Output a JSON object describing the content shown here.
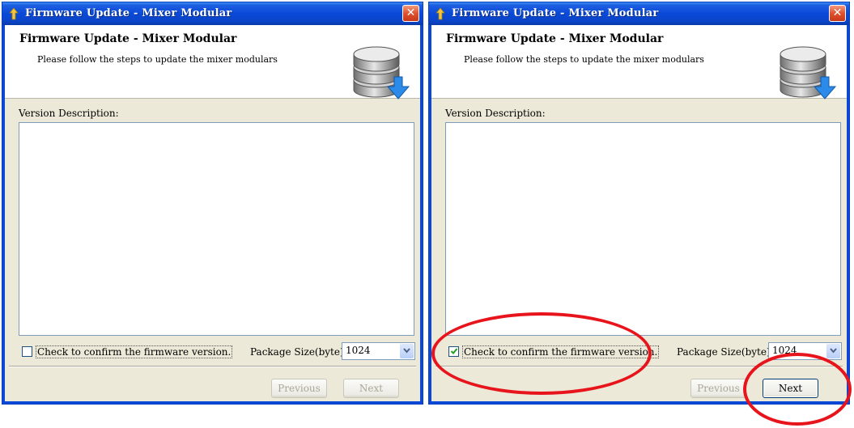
{
  "colors": {
    "annotation": "#e8141c",
    "titlebar": "#0a49d8",
    "close": "#e0512d"
  },
  "windows": [
    {
      "title": "Firmware Update - Mixer Modular",
      "close_icon": "close-icon",
      "header_title": "Firmware Update - Mixer Modular",
      "header_subtitle": "Please follow the steps to update the mixer modulars",
      "header_icon": "database-download-icon",
      "version_label": "Version Description:",
      "version_text": "",
      "confirm_label": "Check to confirm the firmware version.",
      "confirm_checked": false,
      "package_label": "Package Size(byte):",
      "package_value": "1024",
      "previous_label": "Previous",
      "next_label": "Next",
      "next_enabled": false
    },
    {
      "title": "Firmware Update - Mixer Modular",
      "close_icon": "close-icon",
      "header_title": "Firmware Update - Mixer Modular",
      "header_subtitle": "Please follow the steps to update the mixer modulars",
      "header_icon": "database-download-icon",
      "version_label": "Version Description:",
      "version_text": "",
      "confirm_label": "Check to confirm the firmware version.",
      "confirm_checked": true,
      "package_label": "Package Size(byte):",
      "package_value": "1024",
      "previous_label": "Previous",
      "next_label": "Next",
      "next_enabled": true
    }
  ]
}
